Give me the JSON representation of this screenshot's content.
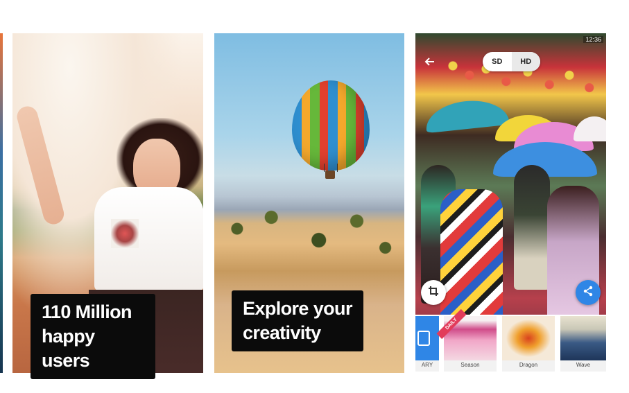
{
  "cards": [
    {
      "caption": "110 Million\nhappy users"
    },
    {
      "caption": "Explore your\ncreativity"
    },
    {
      "quality": {
        "options": [
          "SD",
          "HD"
        ],
        "selected": "HD"
      },
      "status_time": "12:36",
      "filters": [
        {
          "label": "ARY",
          "icon": "library-icon"
        },
        {
          "label": "Season",
          "badge": "DAILY"
        },
        {
          "label": "Dragon"
        },
        {
          "label": "Wave"
        }
      ],
      "buttons": {
        "crop_icon": "crop-icon",
        "share_icon": "share-icon",
        "back_icon": "back-arrow-icon"
      }
    }
  ],
  "colors": {
    "caption_bg": "#0b0b0b",
    "caption_text": "#ffffff",
    "share_button": "#2f86e6"
  }
}
